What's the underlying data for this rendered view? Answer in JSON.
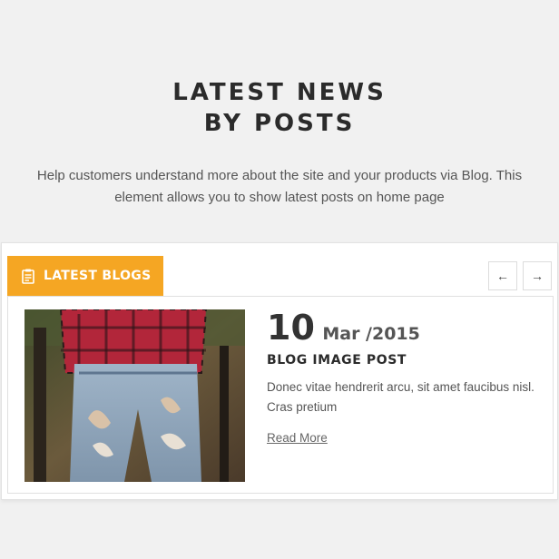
{
  "section": {
    "title_line1": "LATEST NEWS",
    "title_line2": "BY POSTS",
    "description": "Help customers understand more about the site and your products via Blog. This element allows you to show latest posts on home page"
  },
  "tab": {
    "label": "LATEST BLOGS",
    "icon": "clipboard-icon",
    "color": "#f5a623"
  },
  "nav": {
    "prev_label": "←",
    "next_label": "→"
  },
  "post": {
    "day": "10",
    "month_year": "Mar /2015",
    "title": "BLOG IMAGE POST",
    "excerpt": "Donec vitae hendrerit arcu, sit amet faucibus nisl. Cras pretium",
    "read_more": "Read More",
    "image_icon": "blog-post-image"
  }
}
